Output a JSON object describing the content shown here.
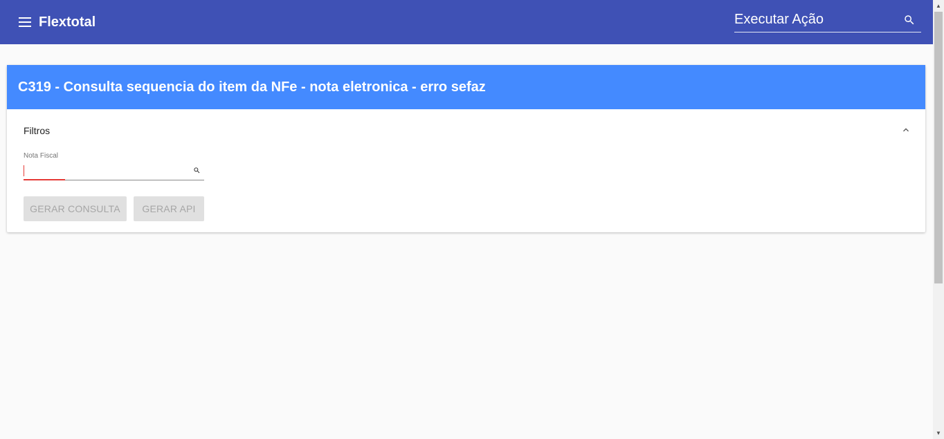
{
  "header": {
    "app_name": "Flextotal",
    "menu_icon": "hamburger-menu-icon",
    "action_search": {
      "placeholder": "Executar Ação",
      "value": "",
      "icon": "search-icon"
    },
    "color": "#3f51b5"
  },
  "card": {
    "title": "C319 - Consulta sequencia do item da NFe - nota eletronica - erro sefaz",
    "header_color": "#448aff",
    "filters": {
      "title": "Filtros",
      "collapse_icon": "chevron-up-icon",
      "fields": [
        {
          "label": "Nota Fiscal",
          "value": "",
          "icon": "search-icon",
          "focused": true
        }
      ]
    },
    "buttons": {
      "generate_query": "GERAR CONSULTA",
      "generate_api": "GERAR API"
    }
  },
  "colors": {
    "focus": "#e53935",
    "disabled_button_bg": "#e0e0e0",
    "disabled_button_text": "#a6a6a6"
  }
}
